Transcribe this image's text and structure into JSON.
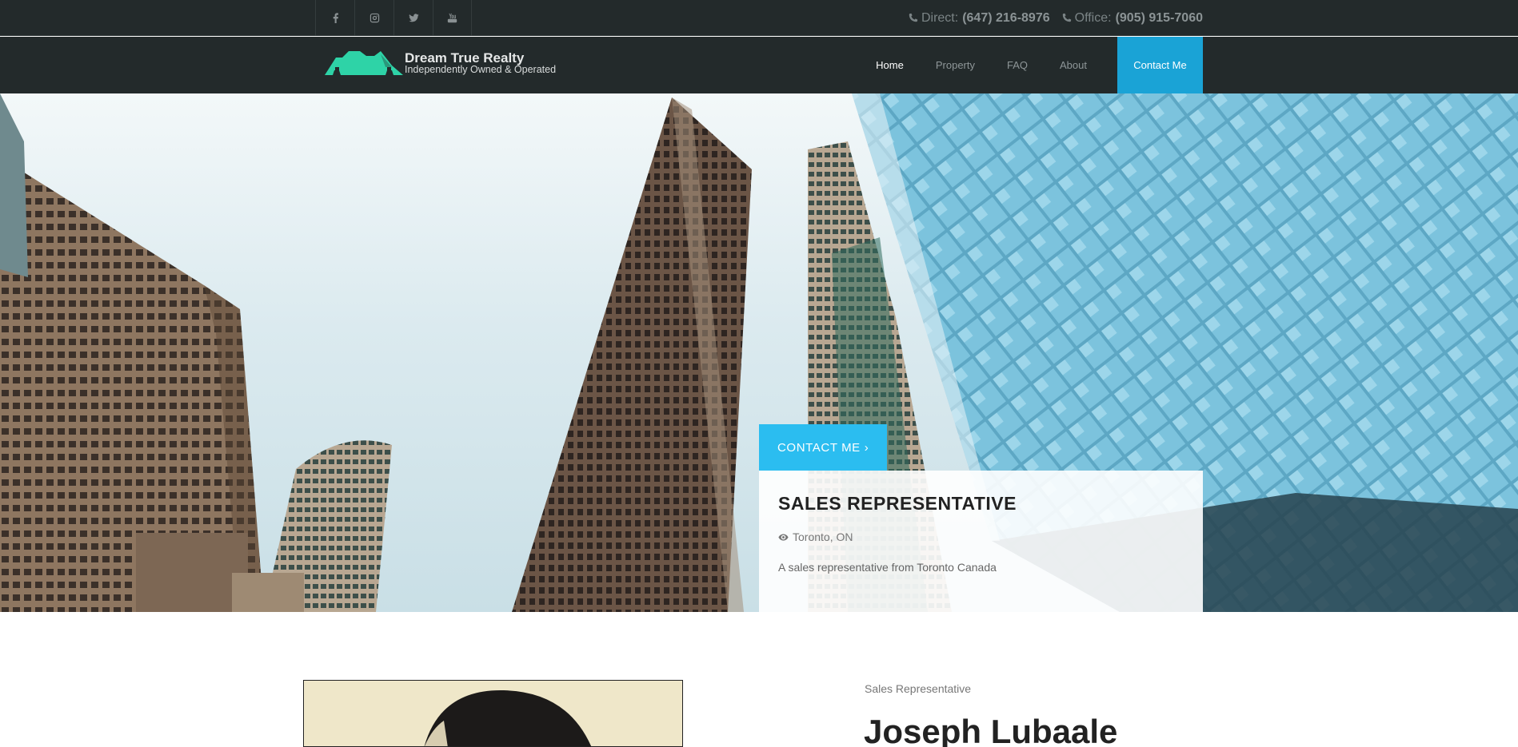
{
  "topbar": {
    "social": [
      "facebook-icon",
      "instagram-icon",
      "twitter-icon",
      "youtube-icon"
    ],
    "direct_label": "Direct:",
    "direct_number": "(647) 216-8976",
    "office_label": "Office:",
    "office_number": "(905) 915-7060"
  },
  "brand": {
    "name": "Dream True Realty",
    "tagline": "Independently Owned & Operated",
    "logo_color": "#2ed3a7"
  },
  "nav": {
    "items": [
      {
        "label": "Home",
        "active": true
      },
      {
        "label": "Property",
        "active": false
      },
      {
        "label": "FAQ",
        "active": false
      },
      {
        "label": "About",
        "active": false
      }
    ],
    "cta_label": "Contact Me",
    "accent": "#1aa3d6"
  },
  "hero": {
    "button_label": "CONTACT ME",
    "button_icon": "chevron-right-icon",
    "button_color": "#2bbdf0",
    "title": "SALES REPRESENTATIVE",
    "location_icon": "eye-icon",
    "location": "Toronto, ON",
    "description": "A sales representative from Toronto Canada"
  },
  "profile": {
    "role": "Sales Representative",
    "name": "Joseph Lubaale"
  }
}
